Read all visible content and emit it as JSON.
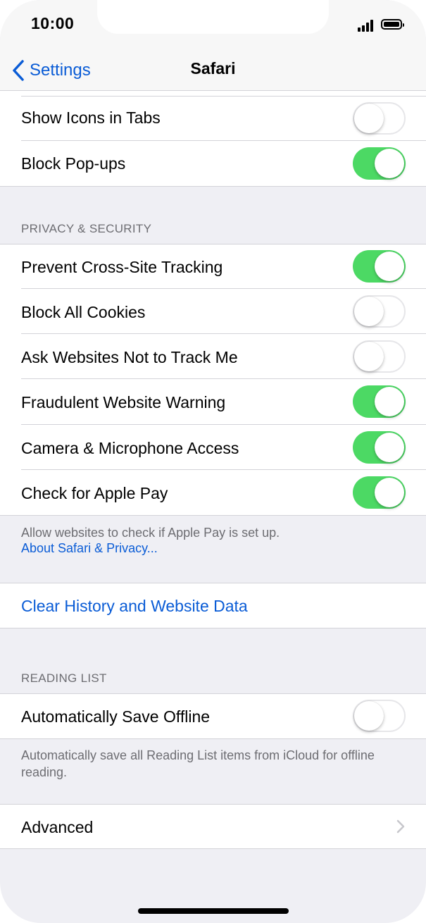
{
  "status_bar": {
    "time": "10:00"
  },
  "nav": {
    "back_label": "Settings",
    "title": "Safari"
  },
  "general": {
    "show_icons_in_tabs": {
      "label": "Show Icons in Tabs",
      "on": false
    },
    "block_popups": {
      "label": "Block Pop-ups",
      "on": true
    }
  },
  "privacy": {
    "header": "PRIVACY & SECURITY",
    "items": [
      {
        "label": "Prevent Cross-Site Tracking",
        "on": true
      },
      {
        "label": "Block All Cookies",
        "on": false
      },
      {
        "label": "Ask Websites Not to Track Me",
        "on": false
      },
      {
        "label": "Fraudulent Website Warning",
        "on": true
      },
      {
        "label": "Camera & Microphone Access",
        "on": true
      },
      {
        "label": "Check for Apple Pay",
        "on": true
      }
    ],
    "footer": "Allow websites to check if Apple Pay is set up.",
    "footer_link": "About Safari & Privacy..."
  },
  "clear_history": {
    "label": "Clear History and Website Data"
  },
  "reading_list": {
    "header": "READING LIST",
    "auto_save": {
      "label": "Automatically Save Offline",
      "on": false
    },
    "footer": "Automatically save all Reading List items from iCloud for offline reading."
  },
  "advanced": {
    "label": "Advanced"
  },
  "colors": {
    "accent": "#0a5cd6",
    "toggle_on": "#4cd964",
    "background": "#efeff4"
  }
}
